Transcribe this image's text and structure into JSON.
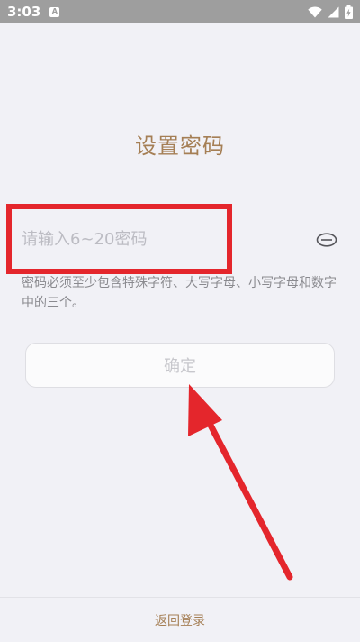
{
  "status_bar": {
    "time": "3:03",
    "notification_letter": "A",
    "icons": [
      "wifi-icon",
      "signal-icon",
      "battery-charging-icon"
    ]
  },
  "page": {
    "title": "设置密码"
  },
  "password_field": {
    "value": "",
    "placeholder": "请输入6~20密码",
    "toggle_icon": "eye-closed-icon"
  },
  "hint": "密码必须至少包含特殊字符、大写字母、小写字母和数字中的三个。",
  "confirm_button": {
    "label": "确定"
  },
  "footer": {
    "back_login_label": "返回登录"
  },
  "annotations": {
    "highlight_color": "#e4262c",
    "arrow_color": "#e4262c"
  },
  "colors": {
    "accent": "#a57f55",
    "background": "#f1f1f6",
    "status_bar": "#9e9e9e"
  }
}
